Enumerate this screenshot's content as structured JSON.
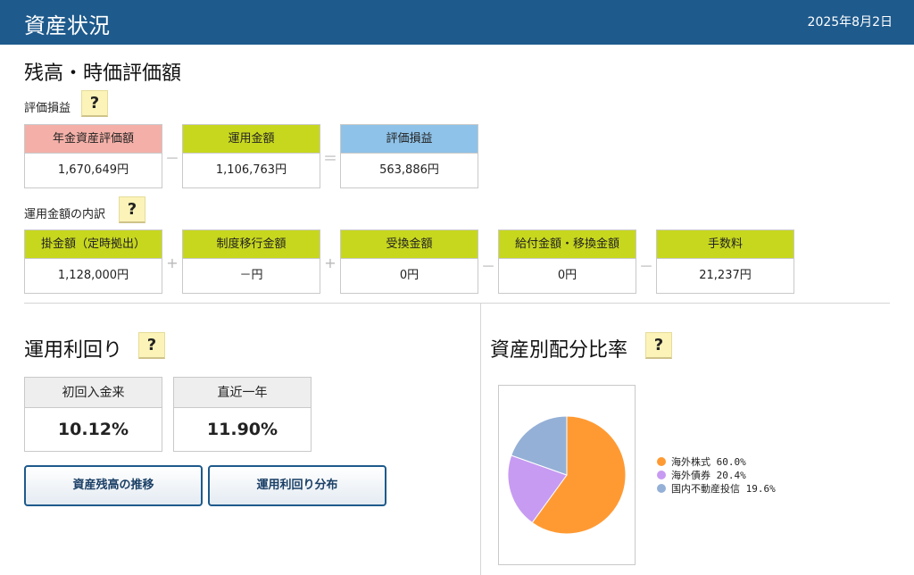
{
  "header": {
    "title": "資産状況",
    "date": "2025年8月2日"
  },
  "balance": {
    "heading": "残高・時価評価額",
    "gain_label": "評価損益",
    "help": "?",
    "boxes": [
      {
        "label": "年金資産評価額",
        "value": "1,670,649円"
      },
      {
        "label": "運用金額",
        "value": "1,106,763円"
      },
      {
        "label": "評価損益",
        "value": "563,886円"
      }
    ],
    "ops": [
      "－",
      "＝"
    ]
  },
  "breakdown": {
    "label": "運用金額の内訳",
    "help": "?",
    "boxes": [
      {
        "label": "掛金額（定時拠出）",
        "value": "1,128,000円"
      },
      {
        "label": "制度移行金額",
        "value": "－円"
      },
      {
        "label": "受換金額",
        "value": "0円"
      },
      {
        "label": "給付金額・移換金額",
        "value": "0円"
      },
      {
        "label": "手数料",
        "value": "21,237円"
      }
    ],
    "ops": [
      "+",
      "+",
      "－",
      "－"
    ]
  },
  "yield": {
    "heading": "運用利回り",
    "help": "?",
    "boxes": [
      {
        "label": "初回入金来",
        "value": "10.12%"
      },
      {
        "label": "直近一年",
        "value": "11.90%"
      }
    ],
    "buttons": {
      "history": "資産残高の推移",
      "distribution": "運用利回り分布"
    }
  },
  "allocation": {
    "heading": "資産別配分比率",
    "help": "?",
    "legend": [
      {
        "label": "海外株式 60.0%"
      },
      {
        "label": "海外債券 20.4%"
      },
      {
        "label": "国内不動産投信 19.6%"
      }
    ]
  },
  "chart_data": {
    "type": "pie",
    "categories": [
      "海外株式",
      "海外債券",
      "国内不動産投信"
    ],
    "values": [
      60.0,
      20.4,
      19.6
    ],
    "colors": [
      "#ff9a33",
      "#c79bf2",
      "#94b0d6"
    ]
  }
}
